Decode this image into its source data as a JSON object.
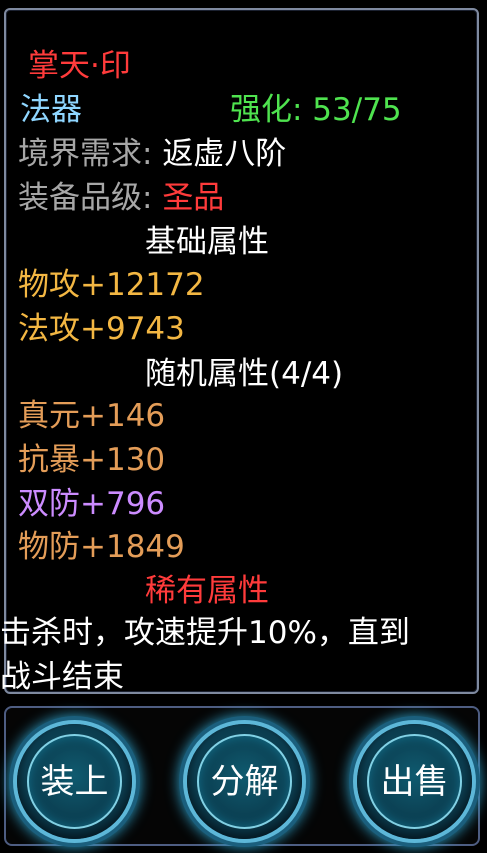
{
  "item": {
    "name": "掌天·印",
    "type": "法器",
    "enhance": "强化: 53/75",
    "realm_label": "境界需求:",
    "realm_value": "返虚八阶",
    "grade_label": "装备品级:",
    "grade_value": "圣品"
  },
  "sections": {
    "base": "基础属性",
    "random": "随机属性(4/4)",
    "rare": "稀有属性"
  },
  "base_stats": [
    "物攻+12172",
    "法攻+9743"
  ],
  "random_stats": [
    "真元+146",
    "抗暴+130",
    "双防+796",
    "物防+1849"
  ],
  "rare_text_line1": "击杀时，攻速提升10%，直到",
  "rare_text_line2": "战斗结束",
  "buttons": {
    "equip": "装上",
    "decompose": "分解",
    "sell": "出售"
  },
  "colors": {
    "title": "#ff3b3b",
    "type": "#8fd6ff",
    "enhance": "#4fe34f",
    "base_stat": "#f3b743",
    "random_stat": "#e49d58",
    "purple_stat": "#cc8cff",
    "rare_section": "#ff3b3b"
  }
}
